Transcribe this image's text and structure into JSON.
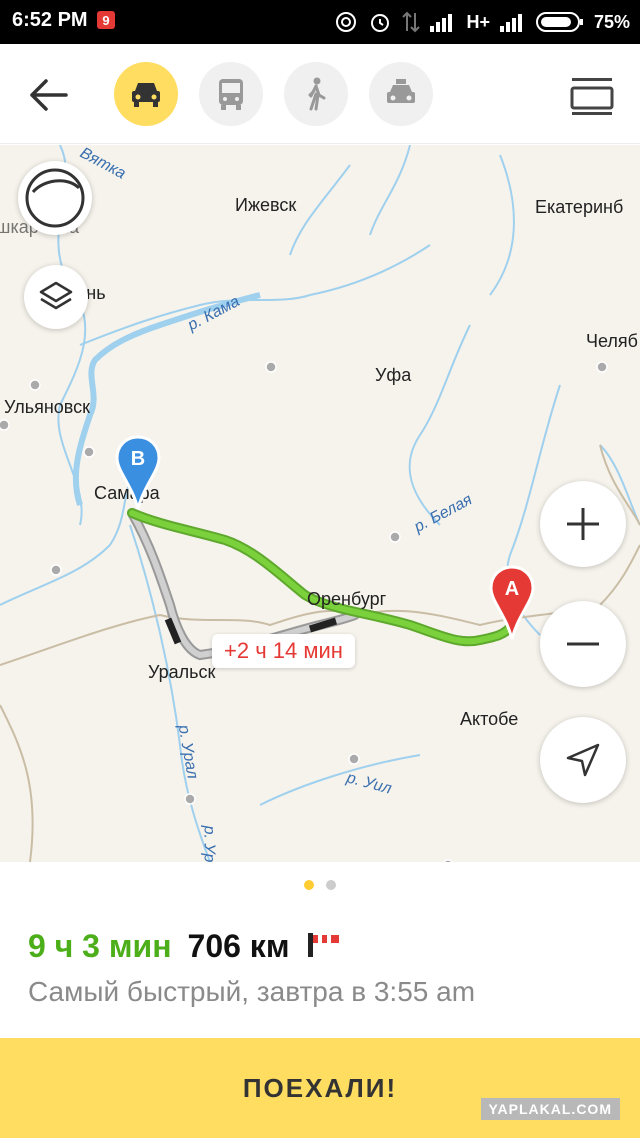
{
  "status_bar": {
    "time": "6:52 PM",
    "network": "H+",
    "battery": "75%"
  },
  "toolbar": {
    "modes": [
      {
        "name": "car",
        "active": true
      },
      {
        "name": "bus",
        "active": false
      },
      {
        "name": "walk",
        "active": false
      },
      {
        "name": "taxi",
        "active": false
      }
    ]
  },
  "map": {
    "cities": {
      "izhevsk": "Ижевск",
      "ekaterinburg": "Екатеринб",
      "kazan_partial": "шкар-Ола",
      "kazan": "зань",
      "chelyabinsk": "Челяб",
      "ufa": "Уфа",
      "ulyanovsk": "Ульяновск",
      "samara": "Самара",
      "orenburg": "Оренбург",
      "uralsk": "Уральск",
      "aktobe": "Актобе"
    },
    "rivers": {
      "vyatka": "Вятка",
      "kama": "р. Кама",
      "belaya": "р. Белая",
      "ural": "р. Урал",
      "ural2": "р. Ур",
      "uil": "р. Уил"
    },
    "pins": {
      "start": "A",
      "end": "B"
    },
    "delay_badge": "+2 ч 14 мин"
  },
  "route": {
    "duration": "9 ч 3 мин",
    "distance": "706 км",
    "subtitle": "Самый быстрый, завтра в 3:55 am",
    "page_count": 2,
    "active_page": 1
  },
  "go_button": "ПОЕХАЛИ!",
  "watermark": "YAPLAKAL.COM",
  "colors": {
    "accent_yellow": "#ffdd60",
    "route_green": "#7bd13b",
    "duration_green": "#4caf19",
    "delay_red": "#e53935",
    "pin_blue": "#3b8fe0",
    "pin_red": "#e53935"
  }
}
